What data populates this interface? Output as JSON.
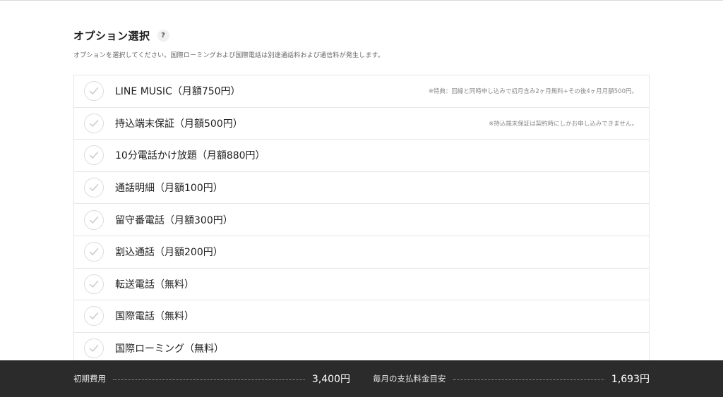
{
  "header": {
    "title": "オプション選択",
    "help_label": "?",
    "description": "オプションを選択してください。国際ローミングおよび国際電話は別途通話料および通信料が発生します。"
  },
  "options": [
    {
      "label": "LINE MUSIC（月額750円）",
      "note": "※特典：回線と同時申し込みで初月含み2ヶ月無料+その後4ヶ月月額500円。",
      "checked": false
    },
    {
      "label": "持込端末保証（月額500円）",
      "note": "※持込端末保証は契約時にしかお申し込みできません。",
      "checked": false
    },
    {
      "label": "10分電話かけ放題（月額880円）",
      "note": "",
      "checked": false
    },
    {
      "label": "通話明細（月額100円）",
      "note": "",
      "checked": false
    },
    {
      "label": "留守番電話（月額300円）",
      "note": "",
      "checked": false
    },
    {
      "label": "割込通話（月額200円）",
      "note": "",
      "checked": false
    },
    {
      "label": "転送電話（無料）",
      "note": "",
      "checked": false
    },
    {
      "label": "国際電話（無料）",
      "note": "",
      "checked": false
    },
    {
      "label": "国際ローミング（無料）",
      "note": "",
      "checked": false
    }
  ],
  "footer": {
    "initial_label": "初期費用",
    "initial_value": "3,400円",
    "monthly_label": "毎月の支払料金目安",
    "monthly_value": "1,693円"
  },
  "colors": {
    "footer_bg": "#2b2b2b",
    "check_color": "#c8c8c8",
    "border": "#e6e6e6"
  },
  "icons": {
    "check": "check-icon",
    "help": "question-icon"
  }
}
